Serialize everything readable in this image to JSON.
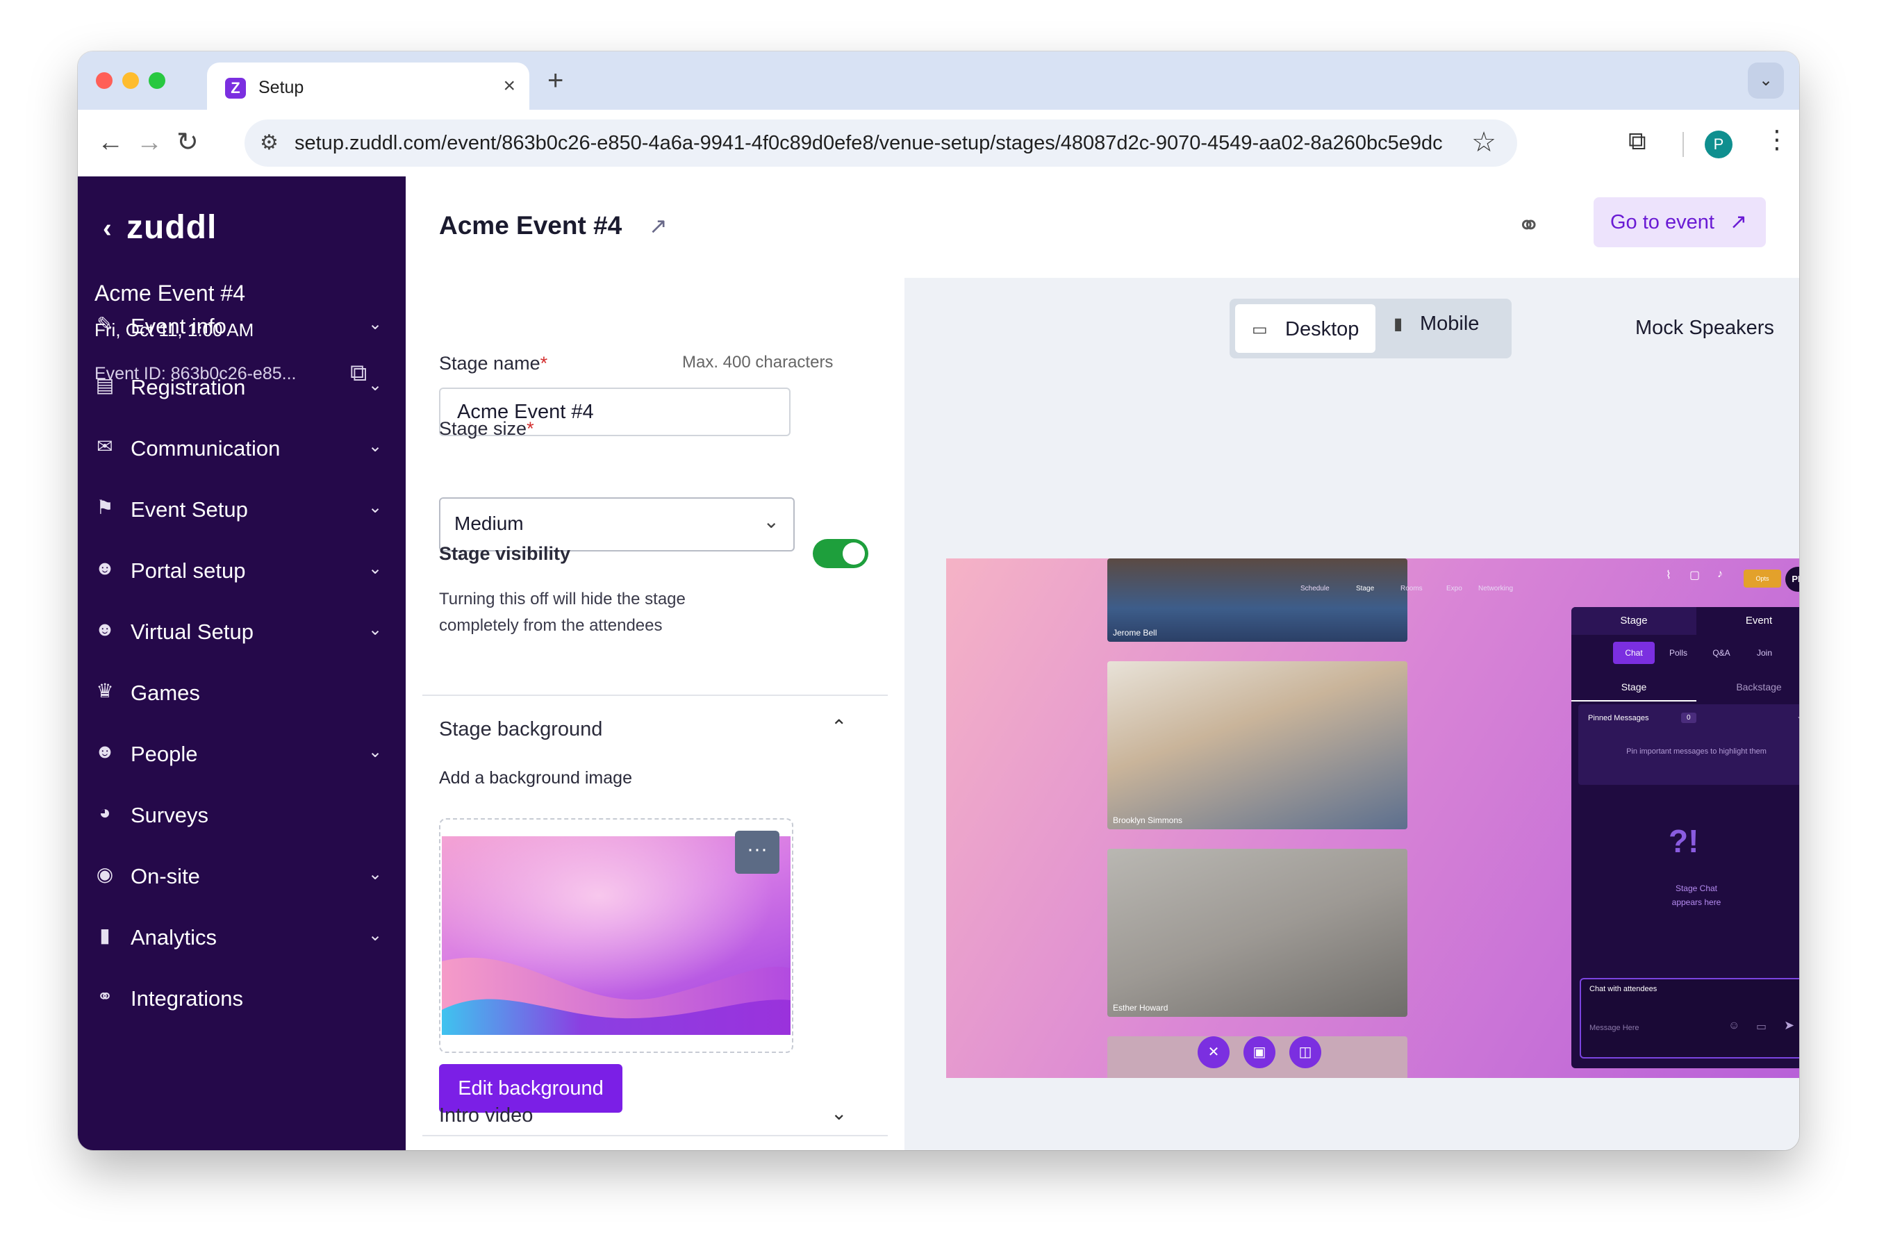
{
  "browser": {
    "tab_title": "Setup",
    "tab_favicon": "Z",
    "url": "setup.zuddl.com/event/863b0c26-e850-4a6a-9941-4f0c89d0efe8/venue-setup/stages/48087d2c-9070-4549-aa02-8a260bc5e9dc",
    "profile_initial": "P",
    "new_tab": "+",
    "close_tab": "×"
  },
  "sidebar": {
    "logo": "zuddl",
    "event_title": "Acme Event #4",
    "event_date": "Fri, Oct 11, 1:00 AM",
    "event_id": "Event ID: 863b0c26-e85...",
    "items": [
      {
        "label": "Event info",
        "icon": "wand-icon",
        "glyph": "✎",
        "chevron": true
      },
      {
        "label": "Registration",
        "icon": "form-icon",
        "glyph": "▤",
        "chevron": true
      },
      {
        "label": "Communication",
        "icon": "mail-icon",
        "glyph": "✉",
        "chevron": true
      },
      {
        "label": "Event Setup",
        "icon": "signpost-icon",
        "glyph": "⚑",
        "chevron": true
      },
      {
        "label": "Portal setup",
        "icon": "people-icon",
        "glyph": "☻",
        "chevron": true
      },
      {
        "label": "Virtual Setup",
        "icon": "people-icon",
        "glyph": "☻",
        "chevron": true
      },
      {
        "label": "Games",
        "icon": "crown-icon",
        "glyph": "♛",
        "chevron": false
      },
      {
        "label": "People",
        "icon": "people-icon",
        "glyph": "☻",
        "chevron": true
      },
      {
        "label": "Surveys",
        "icon": "pie-icon",
        "glyph": "◕",
        "chevron": false
      },
      {
        "label": "On-site",
        "icon": "compass-icon",
        "glyph": "◉",
        "chevron": true
      },
      {
        "label": "Analytics",
        "icon": "bar-chart-icon",
        "glyph": "▮",
        "chevron": true
      },
      {
        "label": "Integrations",
        "icon": "link-icon",
        "glyph": "⚭",
        "chevron": false
      }
    ]
  },
  "header": {
    "title": "Acme Event #4",
    "go_to_event": "Go to event"
  },
  "form": {
    "stage_name_label": "Stage name",
    "stage_name_hint": "Max. 400 characters",
    "stage_name_value": "Acme Event #4",
    "stage_size_label": "Stage size",
    "stage_size_value": "Medium",
    "visibility_label": "Stage visibility",
    "visibility_on": true,
    "visibility_desc": "Turning this off will hide the stage completely from the attendees",
    "bg_section_title": "Stage background",
    "bg_add_label": "Add a background image",
    "edit_bg_button": "Edit background",
    "intro_video_title": "Intro video",
    "required_mark": "*"
  },
  "preview": {
    "device_desktop": "Desktop",
    "device_mobile": "Mobile",
    "mock_speakers_label": "Mock Speakers",
    "mock_speakers_on": true,
    "speakers": [
      "Jerome Bell",
      "Brooklyn Simmons",
      "Esther Howard"
    ],
    "top_nav": [
      "Schedule",
      "Stage",
      "Rooms",
      "Expo",
      "Networking"
    ],
    "avatar_initials": "PP",
    "opts_label": "Opts",
    "chat_tabs": [
      "Stage",
      "Event"
    ],
    "chat_pills": [
      "Chat",
      "Polls",
      "Q&A",
      "Join"
    ],
    "chat_subtabs": [
      "Stage",
      "Backstage"
    ],
    "pinned_title": "Pinned Messages",
    "pinned_count": "0",
    "pinned_hint": "Pin important messages to highlight them",
    "stage_chat_title": "Stage Chat",
    "stage_chat_sub": "appears here",
    "chat_input_label": "Chat with attendees",
    "chat_input_placeholder": "Message Here"
  },
  "colors": {
    "sidebar_bg": "#25094a",
    "accent": "#7b1fe6",
    "toggle_on": "#1e9f3c",
    "preview_bg": "#eef1f6"
  }
}
